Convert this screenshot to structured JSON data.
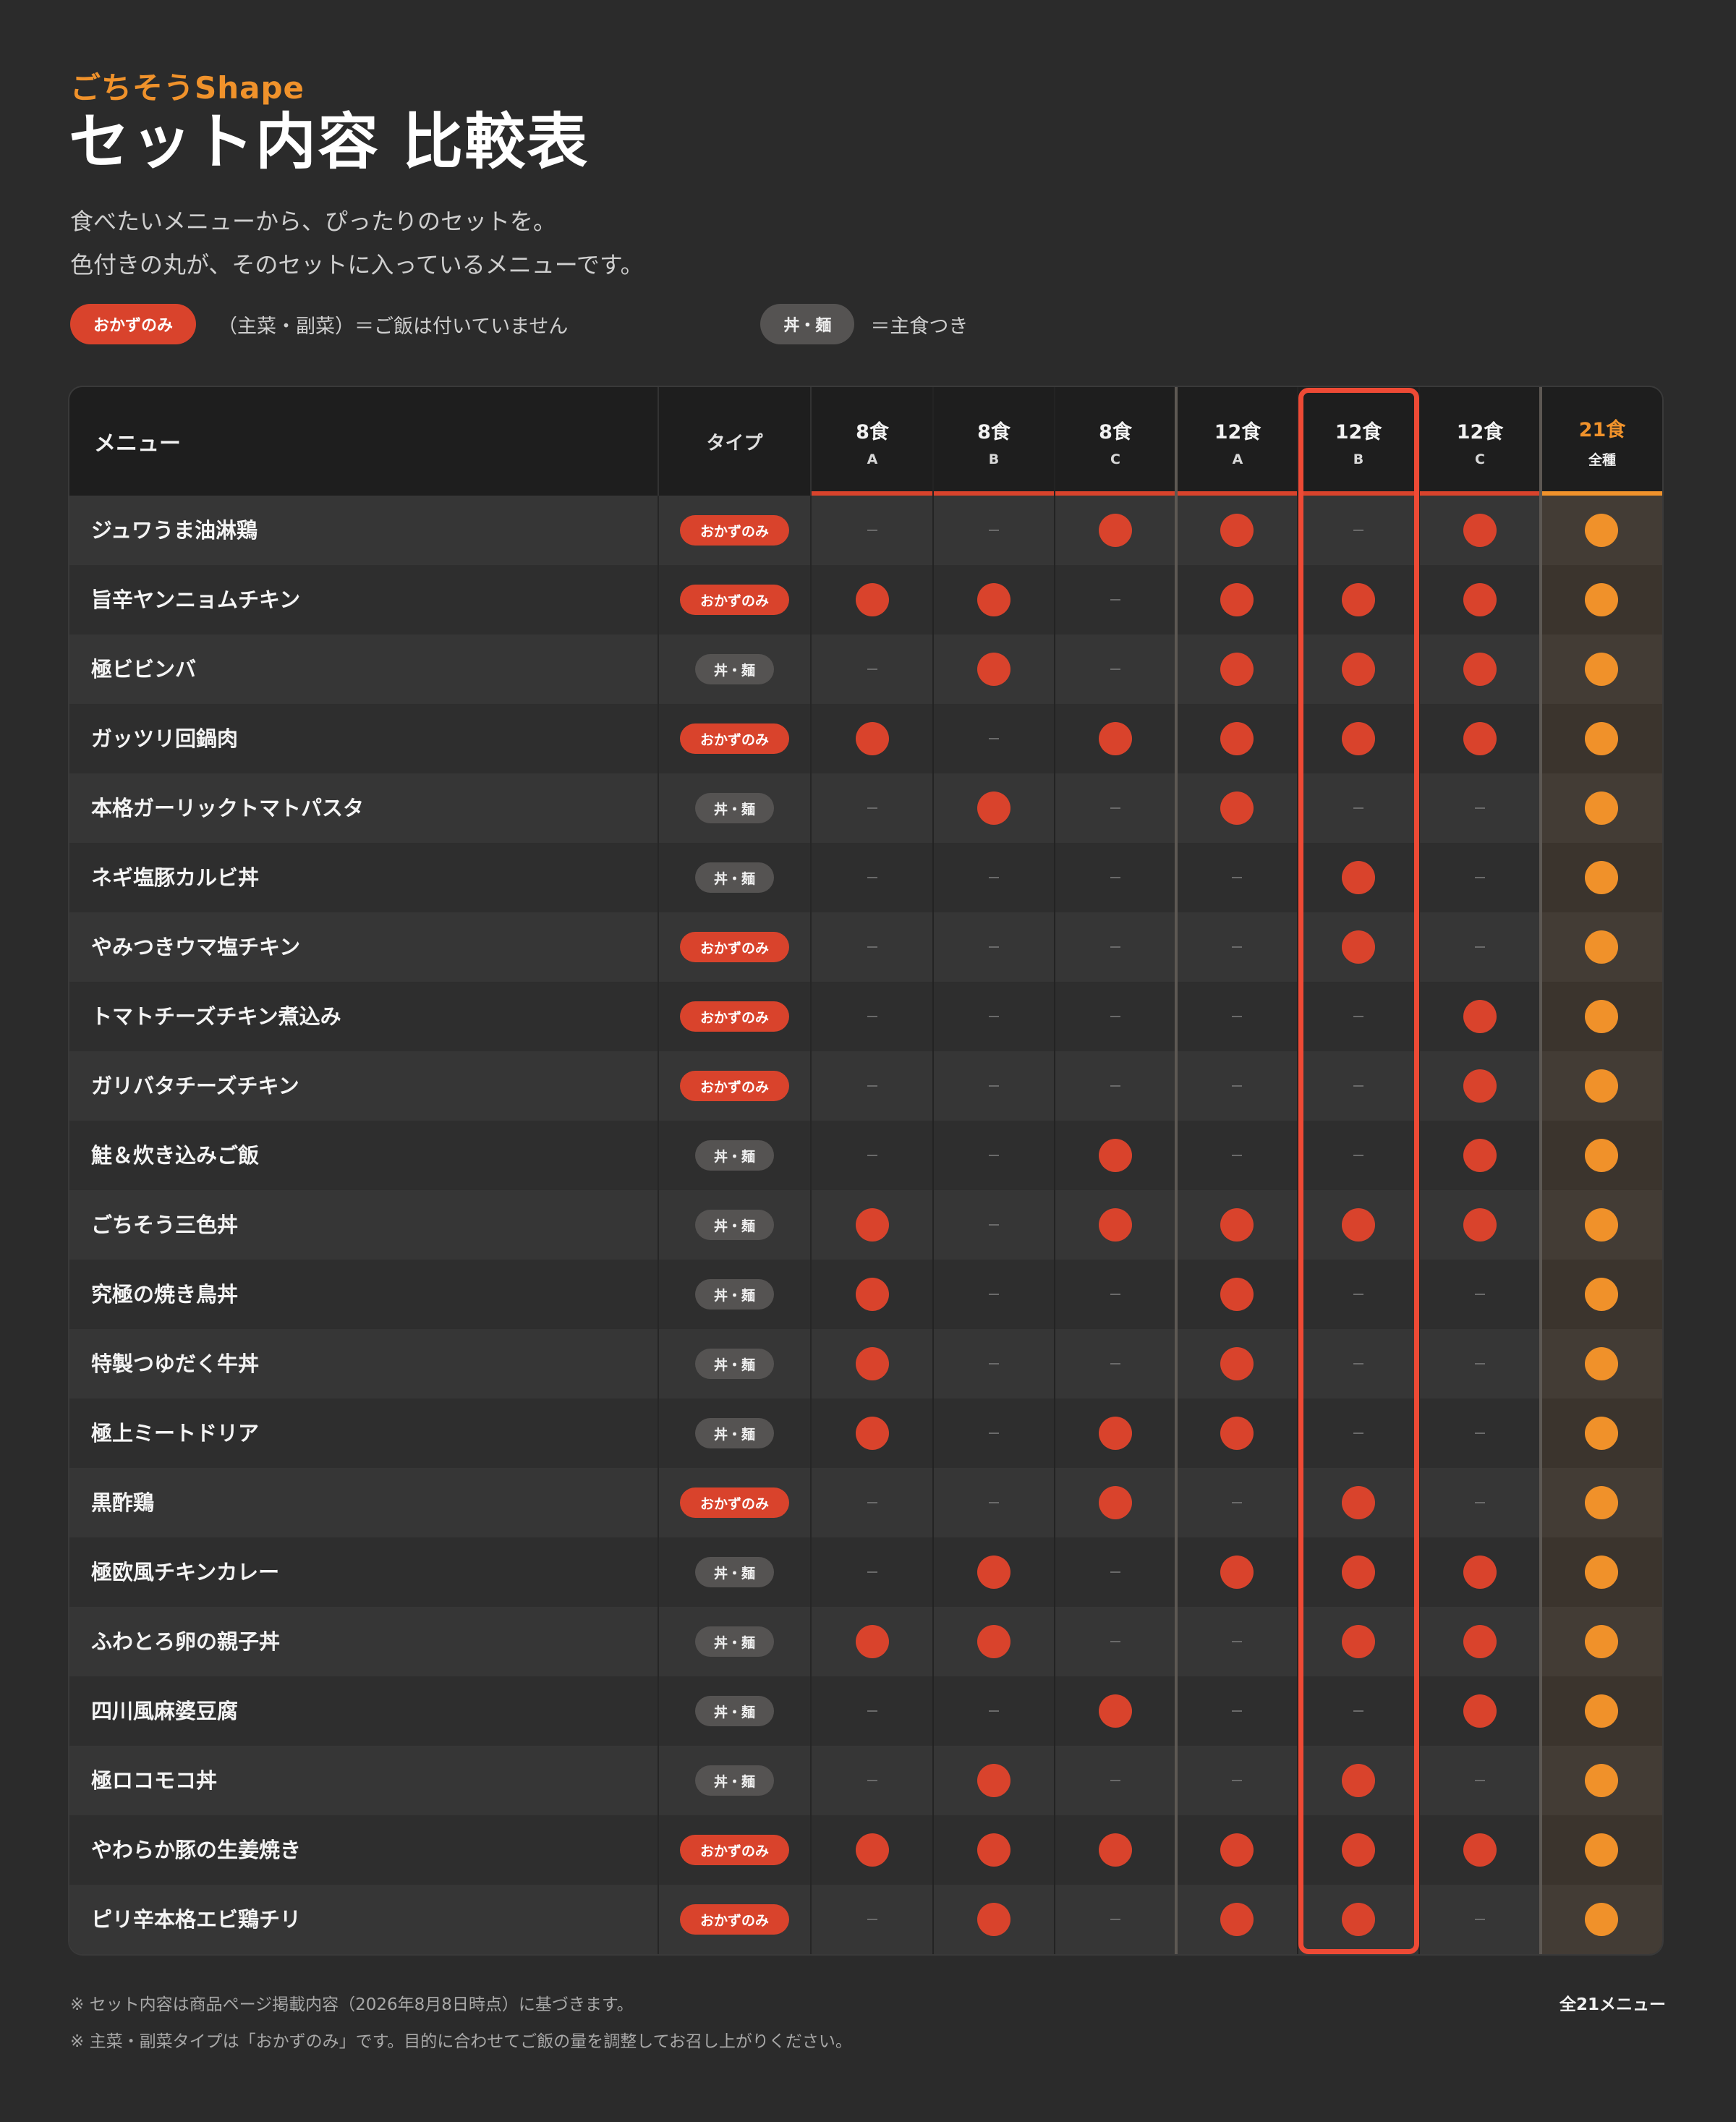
{
  "header": {
    "brand": "ごちそうShape",
    "title": "セット内容 比較表",
    "lead_1": "食べたいメニューから、ぴったりのセットを。",
    "lead_2": "色付きの丸が、そのセットに入っているメニューです。"
  },
  "legend": {
    "okazu_label": "おかずのみ",
    "okazu_text": "（主菜・副菜）＝ご飯は付いていません",
    "don_label": "丼・麺",
    "don_text": "＝主食つき"
  },
  "table": {
    "menu_header": "メニュー",
    "type_header": "タイプ",
    "sets": [
      {
        "name": "8食",
        "sub": "A"
      },
      {
        "name": "8食",
        "sub": "B"
      },
      {
        "name": "8食",
        "sub": "C"
      },
      {
        "name": "12食",
        "sub": "A"
      },
      {
        "name": "12食",
        "sub": "B"
      },
      {
        "name": "12食",
        "sub": "C"
      },
      {
        "name": "21食",
        "sub": "全種"
      }
    ],
    "highlighted_set": "12食 B",
    "types": {
      "okazu": "おかずのみ",
      "don": "丼・麺"
    },
    "rows": [
      {
        "name": "ジュワうま油淋鶏",
        "type": "okazu",
        "sets": [
          0,
          0,
          1,
          1,
          0,
          1,
          1
        ]
      },
      {
        "name": "旨辛ヤンニョムチキン",
        "type": "okazu",
        "sets": [
          1,
          1,
          0,
          1,
          1,
          1,
          1
        ]
      },
      {
        "name": "極ビビンバ",
        "type": "don",
        "sets": [
          0,
          1,
          0,
          1,
          1,
          1,
          1
        ]
      },
      {
        "name": "ガッツリ回鍋肉",
        "type": "okazu",
        "sets": [
          1,
          0,
          1,
          1,
          1,
          1,
          1
        ]
      },
      {
        "name": "本格ガーリックトマトパスタ",
        "type": "don",
        "sets": [
          0,
          1,
          0,
          1,
          0,
          0,
          1
        ]
      },
      {
        "name": "ネギ塩豚カルビ丼",
        "type": "don",
        "sets": [
          0,
          0,
          0,
          0,
          1,
          0,
          1
        ]
      },
      {
        "name": "やみつきウマ塩チキン",
        "type": "okazu",
        "sets": [
          0,
          0,
          0,
          0,
          1,
          0,
          1
        ]
      },
      {
        "name": "トマトチーズチキン煮込み",
        "type": "okazu",
        "sets": [
          0,
          0,
          0,
          0,
          0,
          1,
          1
        ]
      },
      {
        "name": "ガリバタチーズチキン",
        "type": "okazu",
        "sets": [
          0,
          0,
          0,
          0,
          0,
          1,
          1
        ]
      },
      {
        "name": "鮭＆炊き込みご飯",
        "type": "don",
        "sets": [
          0,
          0,
          1,
          0,
          0,
          1,
          1
        ]
      },
      {
        "name": "ごちそう三色丼",
        "type": "don",
        "sets": [
          1,
          0,
          1,
          1,
          1,
          1,
          1
        ]
      },
      {
        "name": "究極の焼き鳥丼",
        "type": "don",
        "sets": [
          1,
          0,
          0,
          1,
          0,
          0,
          1
        ]
      },
      {
        "name": "特製つゆだく牛丼",
        "type": "don",
        "sets": [
          1,
          0,
          0,
          1,
          0,
          0,
          1
        ]
      },
      {
        "name": "極上ミートドリア",
        "type": "don",
        "sets": [
          1,
          0,
          1,
          1,
          0,
          0,
          1
        ]
      },
      {
        "name": "黒酢鶏",
        "type": "okazu",
        "sets": [
          0,
          0,
          1,
          0,
          1,
          0,
          1
        ]
      },
      {
        "name": "極欧風チキンカレー",
        "type": "don",
        "sets": [
          0,
          1,
          0,
          1,
          1,
          1,
          1
        ]
      },
      {
        "name": "ふわとろ卵の親子丼",
        "type": "don",
        "sets": [
          1,
          1,
          0,
          0,
          1,
          1,
          1
        ]
      },
      {
        "name": "四川風麻婆豆腐",
        "type": "don",
        "sets": [
          0,
          0,
          1,
          0,
          0,
          1,
          1
        ]
      },
      {
        "name": "極ロコモコ丼",
        "type": "don",
        "sets": [
          0,
          1,
          0,
          0,
          1,
          0,
          1
        ]
      },
      {
        "name": "やわらか豚の生姜焼き",
        "type": "okazu",
        "sets": [
          1,
          1,
          1,
          1,
          1,
          1,
          1
        ]
      },
      {
        "name": "ピリ辛本格エビ鶏チリ",
        "type": "okazu",
        "sets": [
          0,
          1,
          0,
          1,
          1,
          0,
          1
        ]
      }
    ]
  },
  "colors": {
    "background": "#2b2b2b",
    "accent_red": "#d9432c",
    "accent_orange": "#f0922b",
    "highlight_border": "#ee4a35"
  },
  "footer": {
    "note_1": "※ セット内容は商品ページ掲載内容（2026年8月8日時点）に基づきます。",
    "note_2": "※ 主菜・副菜タイプは「おかずのみ」です。目的に合わせてご飯の量を調整してお召し上がりください。",
    "total": "全21メニュー"
  }
}
